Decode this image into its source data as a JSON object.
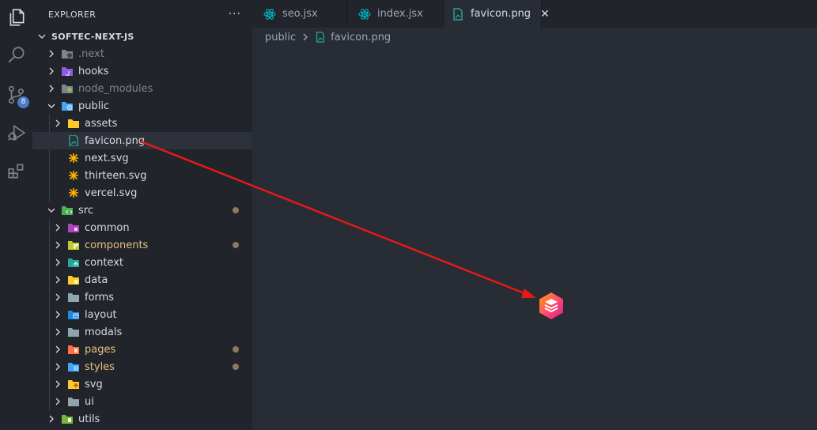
{
  "activity_bar": {
    "icons": [
      "explorer-icon",
      "search-icon",
      "source-control-icon",
      "run-debug-icon",
      "extensions-icon"
    ],
    "scm_badge": "8"
  },
  "sidebar": {
    "title": "EXPLORER",
    "more": "···",
    "root": "SOFTEC-NEXT-JS",
    "items": [
      {
        "label": ".next"
      },
      {
        "label": "hooks"
      },
      {
        "label": "node_modules"
      },
      {
        "label": "public"
      },
      {
        "label": "assets"
      },
      {
        "label": "favicon.png"
      },
      {
        "label": "next.svg"
      },
      {
        "label": "thirteen.svg"
      },
      {
        "label": "vercel.svg"
      },
      {
        "label": "src"
      },
      {
        "label": "common"
      },
      {
        "label": "components"
      },
      {
        "label": "context"
      },
      {
        "label": "data"
      },
      {
        "label": "forms"
      },
      {
        "label": "layout"
      },
      {
        "label": "modals"
      },
      {
        "label": "pages"
      },
      {
        "label": "styles"
      },
      {
        "label": "svg"
      },
      {
        "label": "ui"
      },
      {
        "label": "utils"
      }
    ]
  },
  "tabs": [
    {
      "label": "seo.jsx"
    },
    {
      "label": "index.jsx"
    },
    {
      "label": "favicon.png",
      "close": "✕"
    }
  ],
  "breadcrumb": {
    "folder": "public",
    "file": "favicon.png"
  },
  "colors": {
    "background": "#282c34",
    "sidebar": "#21252b",
    "arrow": "#e21a1a",
    "modified": "#e5c07b"
  }
}
